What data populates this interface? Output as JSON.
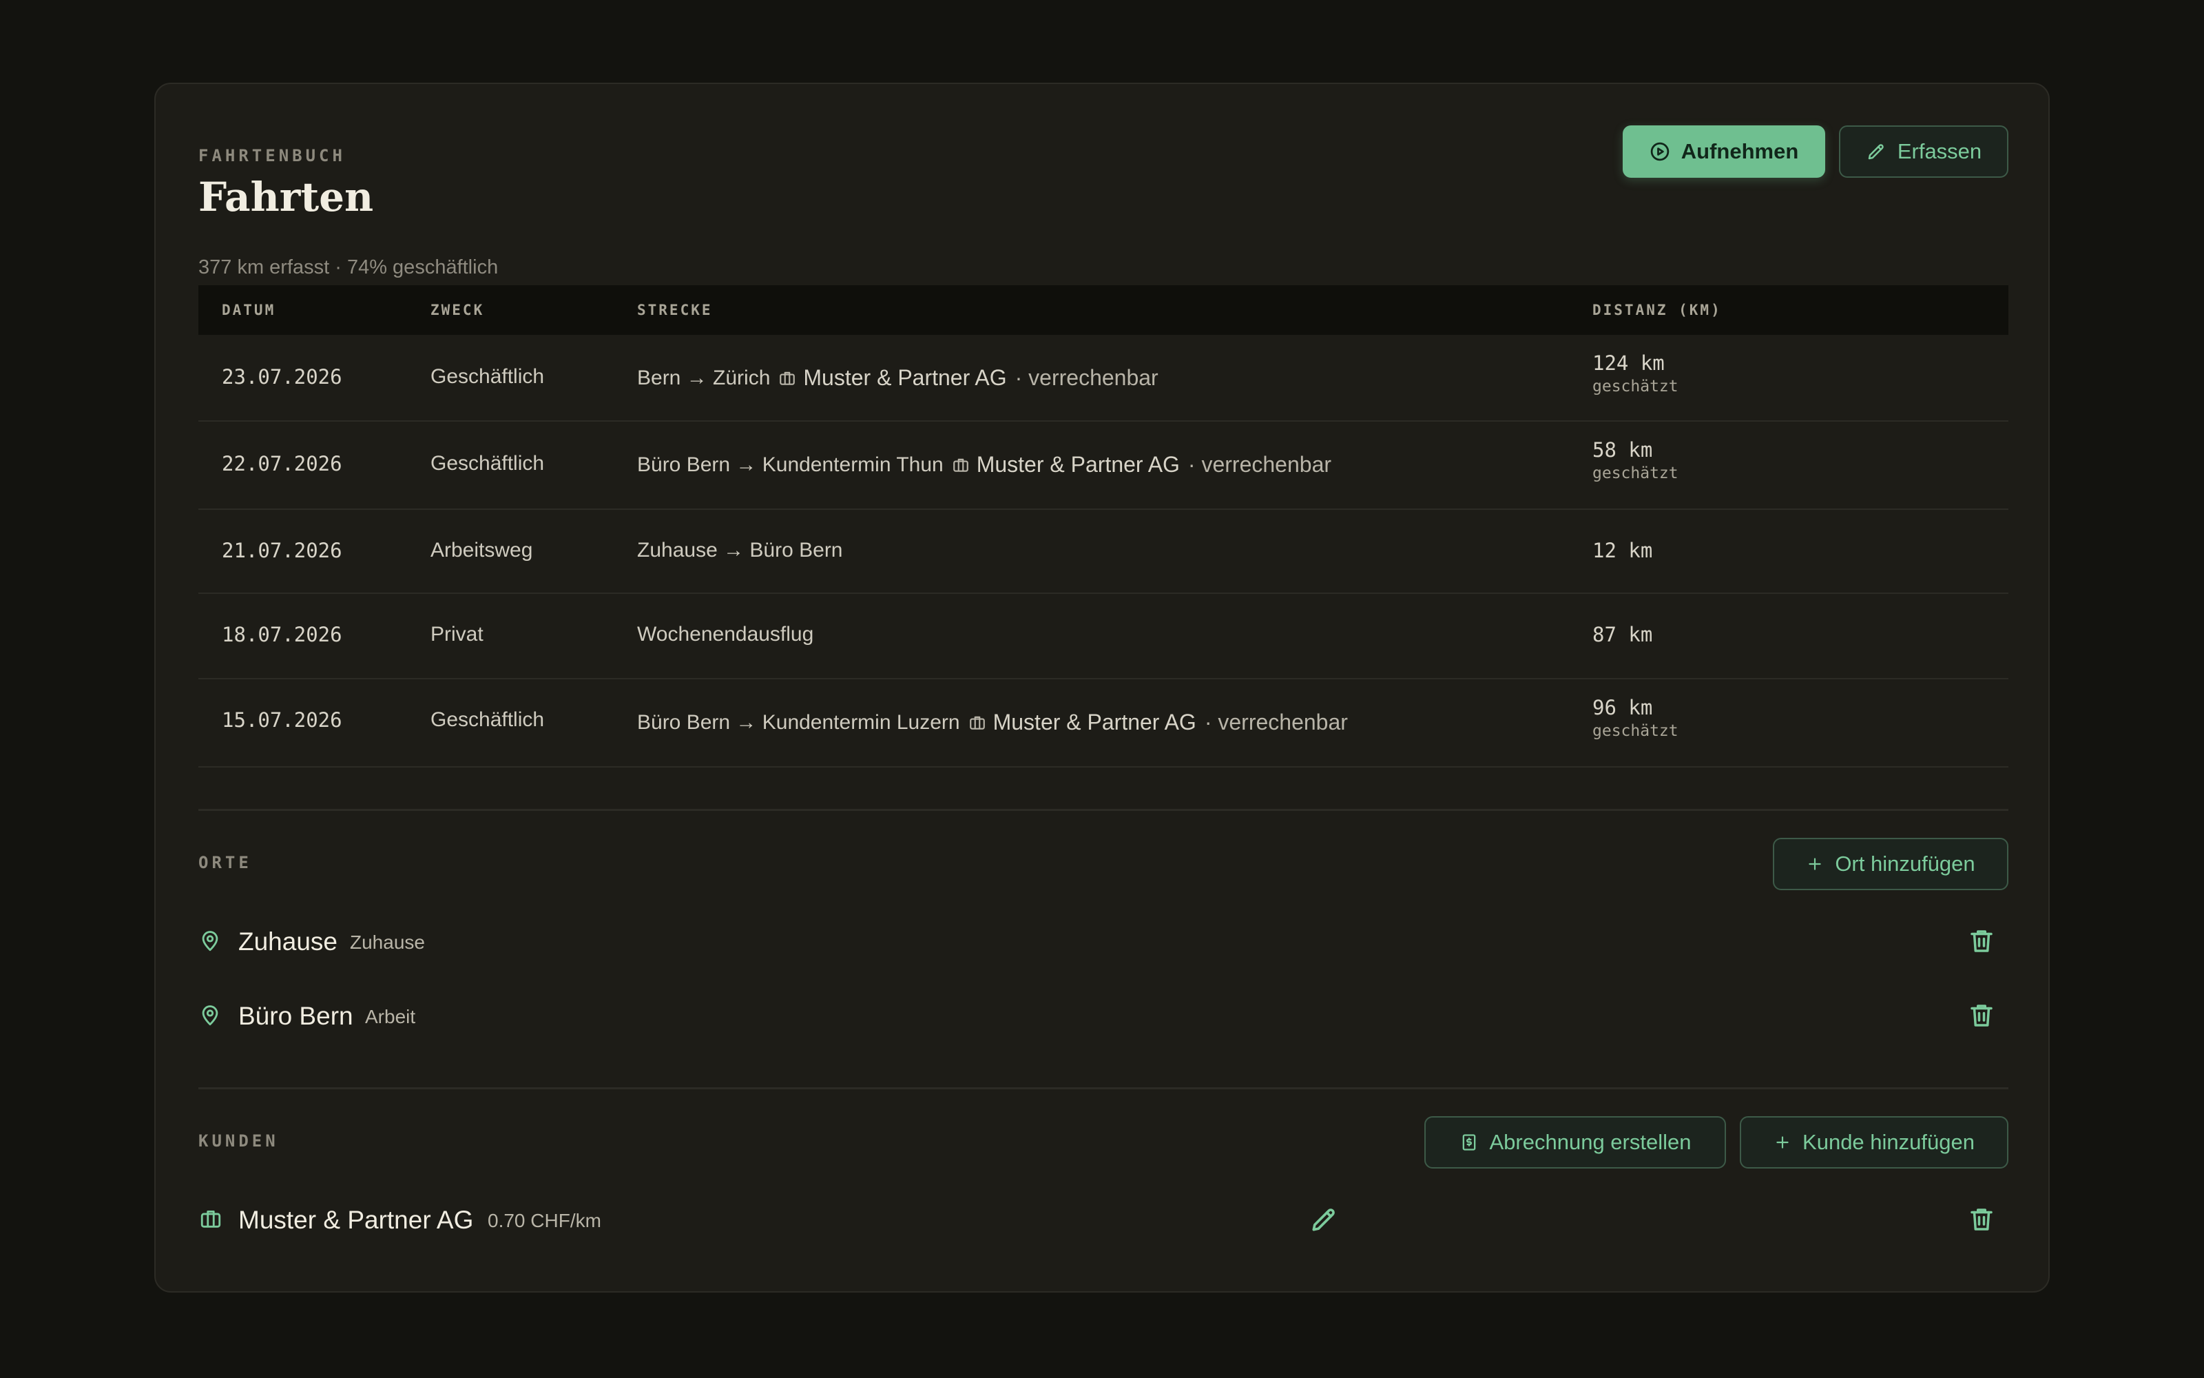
{
  "header": {
    "eyebrow": "FAHRTENBUCH",
    "title": "Fahrten",
    "summary": "377 km erfasst · 74% geschäftlich",
    "record_button": "Aufnehmen",
    "capture_button": "Erfassen"
  },
  "table": {
    "columns": [
      "DATUM",
      "ZWECK",
      "STRECKE",
      "DISTANZ (KM)"
    ],
    "rows": [
      {
        "date": "23.07.2026",
        "purpose": "Geschäftlich",
        "route": "Bern → Zürich",
        "client": "Muster & Partner AG",
        "billing": "· verrechenbar",
        "distance": "124 km",
        "note": "geschätzt"
      },
      {
        "date": "22.07.2026",
        "purpose": "Geschäftlich",
        "route": "Büro Bern → Kundentermin Thun",
        "client": "Muster & Partner AG",
        "billing": "· verrechenbar",
        "distance": "58 km",
        "note": "geschätzt"
      },
      {
        "date": "21.07.2026",
        "purpose": "Arbeitsweg",
        "route": "Zuhause → Büro Bern",
        "client": "",
        "billing": "",
        "distance": "12 km",
        "note": ""
      },
      {
        "date": "18.07.2026",
        "purpose": "Privat",
        "route": "Wochenendausflug",
        "client": "",
        "billing": "",
        "distance": "87 km",
        "note": ""
      },
      {
        "date": "15.07.2026",
        "purpose": "Geschäftlich",
        "route": "Büro Bern → Kundentermin Luzern",
        "client": "Muster & Partner AG",
        "billing": "· verrechenbar",
        "distance": "96 km",
        "note": "geschätzt"
      }
    ]
  },
  "places": {
    "heading": "ORTE",
    "add_button": "Ort hinzufügen",
    "items": [
      {
        "name": "Zuhause",
        "type": "Zuhause"
      },
      {
        "name": "Büro Bern",
        "type": "Arbeit"
      }
    ]
  },
  "clients": {
    "heading": "KUNDEN",
    "invoice_button": "Abrechnung erstellen",
    "add_button": "Kunde hinzufügen",
    "items": [
      {
        "name": "Muster & Partner AG",
        "rate": "0.70 CHF/km"
      }
    ]
  },
  "colors": {
    "background": "#13130f",
    "card": "#1d1c17",
    "accent": "#6fbf90",
    "accent_text": "#7ccb9c"
  }
}
